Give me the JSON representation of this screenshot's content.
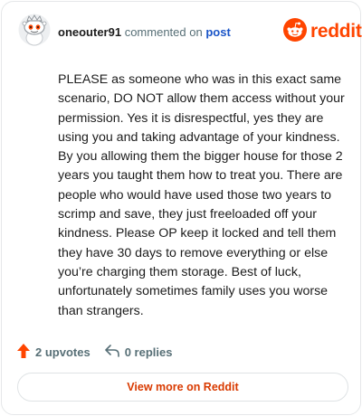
{
  "header": {
    "username": "oneouter91",
    "commented_on": "commented on",
    "post_link": "post",
    "brand": "reddit"
  },
  "comment": {
    "body": "PLEASE as someone who was in this exact same scenario, DO NOT allow them access without your permission. Yes it is disrespectful, yes they are using you and taking advantage of your kindness. By you allowing them the bigger house for those 2 years you taught them how to treat you. There are people who would have used those two years to scrimp and save, they just freeloaded off your kindness. Please OP keep it locked and tell them they have 30 days to remove everything or else you’re charging them storage. Best of luck, unfortunately sometimes family uses you worse than strangers."
  },
  "actions": {
    "upvotes": "2 upvotes",
    "replies": "0 replies"
  },
  "footer": {
    "view_more": "View more on Reddit"
  },
  "colors": {
    "brand": "#ff4500",
    "link": "#1a55c8",
    "muted": "#576f76",
    "view_more": "#d93a00"
  },
  "icons": [
    "snoo-avatar-icon",
    "reddit-logo-icon",
    "upvote-arrow-icon",
    "reply-arrow-icon"
  ]
}
